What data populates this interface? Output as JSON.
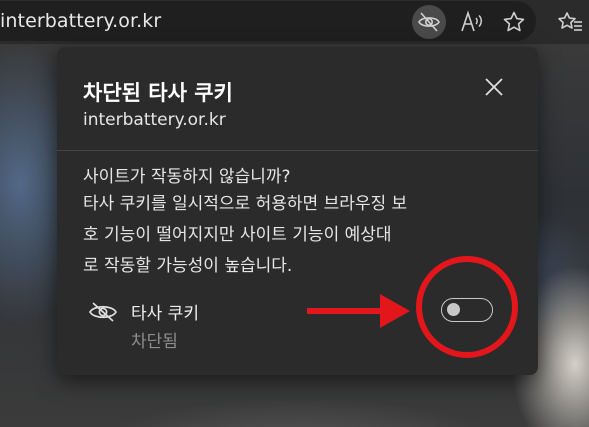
{
  "address_bar": {
    "url": "interbattery.or.kr",
    "icons": [
      "eye-slash-icon",
      "read-aloud-icon",
      "star-icon",
      "favorites-icon"
    ]
  },
  "popup": {
    "title": "차단된 타사 쿠키",
    "domain": "interbattery.or.kr",
    "message_lines": [
      "사이트가 작동하지 않습니까?",
      "타사 쿠키를 일시적으로 허용하면 브라우징 보",
      "호 기능이 떨어지지만 사이트 기능이 예상대",
      "로 작동할 가능성이 높습니다."
    ],
    "setting": {
      "label": "타사 쿠키",
      "status": "차단됨",
      "toggle_on": false
    }
  },
  "colors": {
    "popup_bg": "#2b2b2b",
    "annotation_red": "#e3171b",
    "muted_text": "#8d8d8d"
  }
}
